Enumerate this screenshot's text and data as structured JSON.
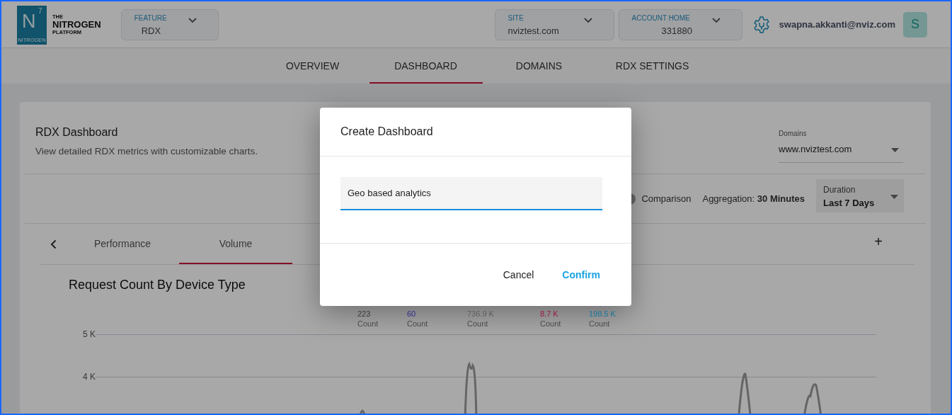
{
  "logo": {
    "mark": "N",
    "superscript": "7",
    "mark_caption": "NITROGEN",
    "line_1": "THE",
    "line_2": "NITROGEN",
    "line_3": "PLATFORM"
  },
  "feature_select": {
    "label": "FEATURE",
    "value": "RDX"
  },
  "site_select": {
    "label": "SITE",
    "value": "nviztest.com"
  },
  "account_select": {
    "label": "ACCOUNT HOME",
    "value": "331880"
  },
  "user": {
    "email": "swapna.akkanti@nviz.com",
    "avatar": "S"
  },
  "nav_tabs": [
    {
      "label": "OVERVIEW",
      "selected": false
    },
    {
      "label": "DASHBOARD",
      "selected": true
    },
    {
      "label": "DOMAINS",
      "selected": false
    },
    {
      "label": "RDX SETTINGS",
      "selected": false
    }
  ],
  "dashboard": {
    "title": "RDX Dashboard",
    "description": "View detailed RDX metrics with customizable charts.",
    "domains_select": {
      "label": "Domains",
      "value": "www.nviztest.com"
    },
    "comparison": {
      "label": "Comparison",
      "on": false
    },
    "aggregation": "Aggregation: **30 Minutes**",
    "duration_select": {
      "label": "Duration",
      "value": "Last 7 Days"
    },
    "tabs": [
      {
        "label": "Performance",
        "selected": false
      },
      {
        "label": "Volume",
        "selected": true
      }
    ],
    "add_tab": "+",
    "chart": {
      "title": "Request Count By Device Type",
      "legend": [
        {
          "value": "223",
          "unit": "Count",
          "color": "#3a3a3a"
        },
        {
          "value": "60",
          "unit": "Count",
          "color": "#2a2a8c"
        },
        {
          "value": "736.9 K",
          "unit": "Count",
          "color": "#5e5e5e"
        },
        {
          "value": "8.7 K",
          "unit": "Count",
          "color": "#9c1448"
        },
        {
          "value": "198.5 K",
          "unit": "Count",
          "color": "#15759c"
        }
      ],
      "y_ticks": [
        "5 K",
        "4 K"
      ]
    }
  },
  "dialog": {
    "title": "Create Dashboard",
    "input_value": "Geo based analytics",
    "buttons": [
      {
        "label": "Cancel",
        "kind": "text"
      },
      {
        "label": "Confirm",
        "kind": "primary"
      }
    ]
  }
}
